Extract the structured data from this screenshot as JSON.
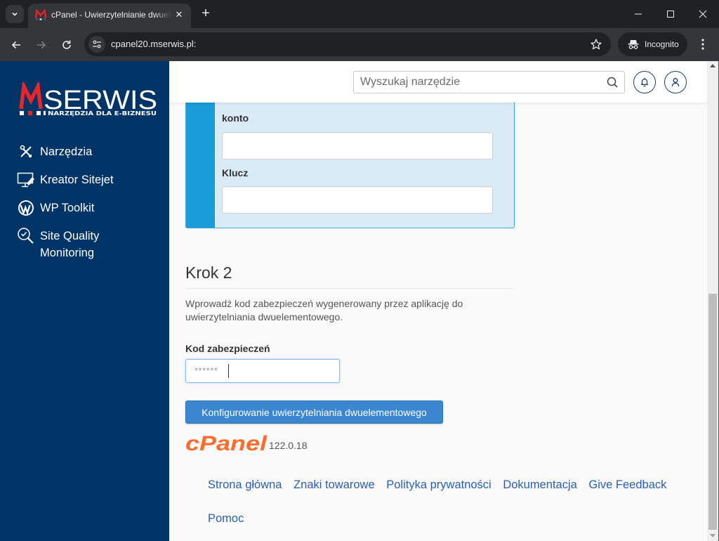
{
  "browser": {
    "tab_title": "cPanel - Uwierzytelnianie dwuelementowe",
    "url": "cpanel20.mserwis.pl:",
    "incognito_label": "Incognito"
  },
  "sidebar": {
    "logo_main": "MSERWIS",
    "logo_tagline": "NARZĘDZIA DLA E-BIZNESU",
    "items": [
      {
        "label": "Narzędzia",
        "icon": "tools-icon"
      },
      {
        "label": "Kreator Sitejet",
        "icon": "sitejet-icon"
      },
      {
        "label": "WP Toolkit",
        "icon": "wordpress-icon"
      },
      {
        "label_line1": "Site Quality",
        "label_line2": "Monitoring",
        "icon": "site-quality-icon"
      }
    ]
  },
  "topbar": {
    "search_placeholder": "Wyszukaj narzędzie"
  },
  "step1_panel": {
    "account_label": "konto",
    "account_value": "",
    "key_label": "Klucz",
    "key_value": ""
  },
  "step2": {
    "heading": "Krok 2",
    "description": "Wprowadź kod zabezpieczeń wygenerowany przez aplikację do uwierzytelniania dwuelementowego.",
    "code_label": "Kod zabezpieczeń",
    "code_value": "******",
    "submit_label": "Konfigurowanie uwierzytelniania dwuelementowego"
  },
  "footer": {
    "brand": "cPanel",
    "version": "122.0.18",
    "links": [
      "Strona główna",
      "Znaki towarowe",
      "Polityka prywatności",
      "Dokumentacja",
      "Give Feedback",
      "Pomoc"
    ]
  },
  "colors": {
    "sidebar_bg": "#003466",
    "primary_button": "#3a87d0",
    "panel_bg": "#d8ebf7",
    "panel_stripe": "#199cd7",
    "link": "#2b5fab",
    "cpanel_orange": "#ff6c2c"
  }
}
